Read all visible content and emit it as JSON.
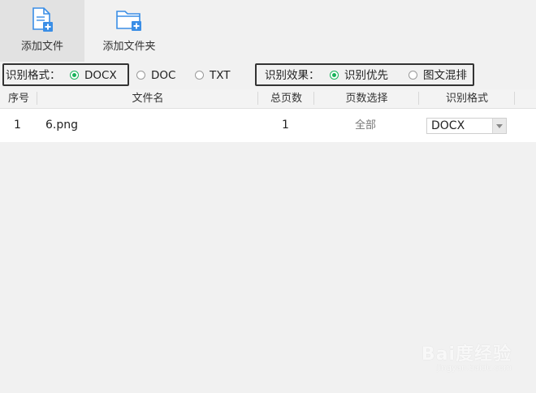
{
  "toolbar": {
    "add_file_label": "添加文件",
    "add_folder_label": "添加文件夹"
  },
  "format_group": {
    "label": "识别格式：",
    "options": [
      "DOCX",
      "DOC",
      "TXT"
    ],
    "selected": "DOCX"
  },
  "effect_group": {
    "label": "识别效果：",
    "options": [
      "识别优先",
      "图文混排"
    ],
    "selected": "识别优先"
  },
  "table": {
    "headers": [
      "序号",
      "文件名",
      "总页数",
      "页数选择",
      "识别格式"
    ],
    "rows": [
      {
        "index": "1",
        "filename": "6.png",
        "pages": "1",
        "page_select": "全部",
        "format": "DOCX"
      }
    ]
  },
  "colors": {
    "accent_green": "#19b35a",
    "icon_blue": "#3a8ee6"
  },
  "watermark": {
    "text": "Bai度经验",
    "sub": "jingyan.baidu.com"
  }
}
